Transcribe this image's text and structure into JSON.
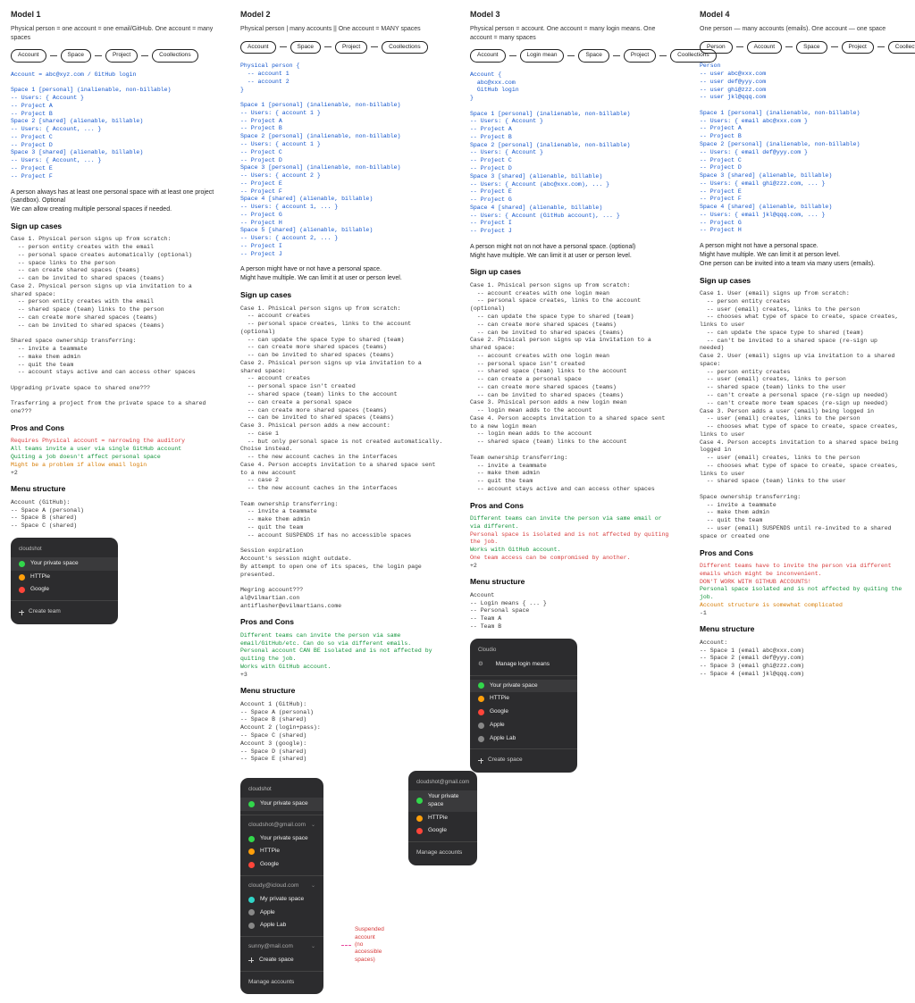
{
  "models": {
    "m1": {
      "title": "Model 1",
      "subtitle": "Physical person = one account = one email/GitHub. One account = many spaces",
      "pills": [
        "Account",
        "Space",
        "Project",
        "Coollections"
      ],
      "hierarchy": "Account = abc@xyz.com / GitHub login\n\nSpace 1 [personal] (inalienable, non-billable)\n-- Users: { Account }\n-- Project A\n-- Project B\nSpace 2 [shared] (alienable, billable)\n-- Users: { Account, ... }\n-- Project C\n-- Project D\nSpace 3 [shared] (alienable, billable)\n-- Users: { Account, ... }\n-- Project E\n-- Project F",
      "note": "A person always has at least one personal space with at least one project (sandbox). Optional\nWe can allow creating multiple personal spaces if needed.",
      "signup_title": "Sign up cases",
      "signup": "Case 1. Physical person signs up from scratch:\n  -- person entity creates with the email\n  -- personal space creates automatically (optional)\n  -- space links to the person\n  -- can create shared spaces (teams)\n  -- can be invited to shared spaces (teams)\nCase 2. Physical person signs up via invitation to a shared space:\n  -- person entity creates with the email\n  -- shared space (team) links to the person\n  -- can create more shared spaces (teams)\n  -- can be invited to shared spaces (teams)\n\nShared space ownership transferring:\n  -- invite a teammate\n  -- make them admin\n  -- quit the team\n  -- account stays active and can access other spaces\n\nUpgrading private space to shared one???\n\nTrasferring a project from the private space to a shared one???",
      "proscons_title": "Pros and Cons",
      "proscons_html": "<span class='r'>Requires Physical account = narrowing the auditory</span>\n<span class='g'>All teams invite a user via single GitHub account</span>\n<span class='g'>Quiting a job doesn't affect personal space</span>\n<span class='o'>Might be a problem if allow email login</span>\n+2",
      "menu_title": "Menu structure",
      "menu": "Account (GitHub):\n-- Space A (personal)\n-- Space B (shared)\n-- Space C (shared)",
      "panel": {
        "header": "cloudshot",
        "items": [
          {
            "dot": "green",
            "label": "Your private space",
            "sel": true
          },
          {
            "dot": "orange",
            "label": "HTTPie"
          },
          {
            "dot": "red",
            "label": "Google"
          }
        ],
        "footer": "Create team"
      }
    },
    "m2": {
      "title": "Model 2",
      "subtitle": "Physical person | many accounts || One account = MANY spaces",
      "pills": [
        "Account",
        "Space",
        "Project",
        "Coollections"
      ],
      "hierarchy": "Physical person {\n  -- account 1\n  -- account 2\n}\n\nSpace 1 [personal] (inalienable, non-billable)\n-- Users: { account 1 }\n-- Project A\n-- Project B\nSpace 2 [personal] (inalienable, non-billable)\n-- Users: { account 1 }\n-- Project C\n-- Project D\nSpace 3 [personal] (inalienable, non-billable)\n-- Users: { account 2 }\n-- Project E\n-- Project F\nSpace 4 [shared] (alienable, billable)\n-- Users: { account 1, ... }\n-- Project G\n-- Project H\nSpace 5 [shared] (alienable, billable)\n-- Users: { account 2, ... }\n-- Project I\n-- Project J",
      "note": "A person might have or not have a personal space.\nMight have multiple. We can limit it at user or person level.",
      "signup_title": "Sign up cases",
      "signup": "Case 1. Phisical person signs up from scratch:\n  -- account creates\n  -- personal space creates, links to the account (optional)\n  -- can update the space type to shared (team)\n  -- can create more shared spaces (teams)\n  -- can be invited to shared spaces (teams)\nCase 2. Phisical person signs up via invitation to a shared space:\n  -- account creates\n  -- personal space isn't created\n  -- shared space (team) links to the account\n  -- can create a personal space\n  -- can create more shared spaces (teams)\n  -- can be invited to shared spaces (teams)\nCase 3. Phisical person adds a new account:\n  -- case 1\n  -- but only personal space is not created automatically.\nChoise instead.\n  -- the new account caches in the interfaces\nCase 4. Person accepts invitation to a shared space sent to a new account\n  -- case 2\n  -- the new account caches in the interfaces\n\nTeam ownership transferring:\n  -- invite a teammate\n  -- make them admin\n  -- quit the team\n  -- account SUSPENDS if has no accessible spaces\n\nSession expiration\nAccount's session might outdate.\nBy attempt to open one of its spaces, the login page presented.\n\nMegring account???\nal@vilmartian.con\nantiflasher@evilmartians.come",
      "proscons_title": "Pros and Cons",
      "proscons_html": "<span class='g'>Different teams can invite the person via same email/GitHub/etc. Can do so via different emails.</span>\n<span class='g'>Personal account CAN BE isolated and is not affected by quiting the job.</span>\n<span class='g'>Works with GitHub account.</span>\n+3",
      "menu_title": "Menu structure",
      "menu": "Account 1 (GitHub):\n-- Space A (personal)\n-- Space B (shared)\nAccount 2 (login+pass):\n-- Space C (shared)\nAccount 3 (google):\n-- Space D (shared)\n-- Space E (shared)",
      "panelA": {
        "header": "cloudshot",
        "blocks": [
          {
            "email": "cloudshot@gmail.com",
            "items": [
              {
                "dot": "green",
                "label": "Your private space",
                "sel": true
              },
              {
                "dot": "orange",
                "label": "HTTPie"
              },
              {
                "dot": "red",
                "label": "Google"
              }
            ]
          },
          {
            "email": "cloudy@icloud.com",
            "items": [
              {
                "dot": "teal",
                "label": "My private space"
              },
              {
                "dot": "gray",
                "label": "Apple"
              },
              {
                "dot": "gray",
                "label": "Apple Lab"
              }
            ]
          },
          {
            "email": "sunny@mail.com",
            "items": [],
            "suspended": true
          }
        ],
        "create": "Create space",
        "footer": "Manage accounts"
      },
      "panelB": {
        "header": "cloudshot@gmail.com",
        "items": [
          {
            "dot": "green",
            "label": "Your private space",
            "sel": true
          },
          {
            "dot": "orange",
            "label": "HTTPie"
          },
          {
            "dot": "red",
            "label": "Google"
          }
        ],
        "footer": "Manage accounts"
      },
      "suspended_label": "Suspended account",
      "suspended_sub": "(no accessible spaces)"
    },
    "m3": {
      "title": "Model 3",
      "subtitle": "Physical person = account. One account = many login means. One account = many spaces",
      "pills": [
        "Account",
        "Login mean",
        "Space",
        "Project",
        "Coollections"
      ],
      "hierarchy": "Account {\n  abc@xxx.com\n  GitHub login\n}\n\nSpace 1 [personal] (inalienable, non-billable)\n-- Users: { Account }\n-- Project A\n-- Project B\nSpace 2 [personal] (inalienable, non-billable)\n-- Users: { Account }\n-- Project C\n-- Project D\nSpace 3 [shared] (alienable, billable)\n-- Users: { Account (abc@xxx.com), ... }\n-- Project E\n-- Project G\nSpace 4 [shared] (alienable, billable)\n-- Users: { Account (GitHub account), ... }\n-- Project I\n-- Project J",
      "note": "A person might not on not have a personal space. (optional)\nMight have multiple. We can limit it at user or person level.",
      "signup_title": "Sign up cases",
      "signup": "Case 1. Phisical person signs up from scratch:\n  -- account creates with one login mean\n  -- personal space creates, links to the account (optional)\n  -- can update the space type to shared (team)\n  -- can create more shared spaces (teams)\n  -- can be invited to shared spaces (teams)\nCase 2. Phisical person signs up via invitation to a shared space:\n  -- account creates with one login mean\n  -- personal space isn't created\n  -- shared space (team) links to the account\n  -- can create a personal space\n  -- can create more shared spaces (teams)\n  -- can be invited to shared spaces (teams)\nCase 3. Phisical person adds a new login mean\n  -- login mean adds to the account\nCase 4. Person accepts invitation to a shared space sent to a new login mean\n  -- login mean adds to the account\n  -- shared space (team) links to the account\n\nTeam ownership transferring:\n  -- invite a teammate\n  -- make them admin\n  -- quit the team\n  -- account stays active and can access other spaces",
      "proscons_title": "Pros and Cons",
      "proscons_html": "<span class='g'>Different teams can invite the person via same email or via different.</span>\n<span class='r'>Personal space is isolated and is not affected by quiting the job.</span>\n<span class='g'>Works with GitHub account.</span>\n<span class='r'>One team access can be compromised by another.</span>\n+2",
      "menu_title": "Menu structure",
      "menu": "Account\n-- Login means { ... }\n-- Personal space\n-- Team A\n-- Team B",
      "panel": {
        "header": "Cloudio",
        "manage": "Manage login means",
        "items": [
          {
            "dot": "green",
            "label": "Your private space",
            "sel": true
          },
          {
            "dot": "orange",
            "label": "HTTPie"
          },
          {
            "dot": "red",
            "label": "Google"
          },
          {
            "dot": "gray",
            "label": "Apple"
          },
          {
            "dot": "gray",
            "label": "Apple Lab"
          }
        ],
        "footer": "Create space"
      }
    },
    "m4": {
      "title": "Model 4",
      "subtitle": "One person — many accounts (emails). One account — one space",
      "pills": [
        "Person",
        "Account",
        "Space",
        "Project",
        "Coollections"
      ],
      "hierarchy": "Person\n-- user abc@xxx.com\n-- user def@yyy.com\n-- user ghi@zzz.com\n-- user jkl@qqq.com\n\nSpace 1 [personal] (inalienable, non-billable)\n-- Users: { email abc@xxx.com }\n-- Project A\n-- Project B\nSpace 2 [personal] (inalienable, non-billable)\n-- Users: { email def@yyy.com }\n-- Project C\n-- Project D\nSpace 3 [shared] (alienable, billable)\n-- Users: { email ghi@zzz.com, ... }\n-- Project E\n-- Project F\nSpace 4 [shared] (alienable, billable)\n-- Users: { email jkl@qqq.com, ... }\n-- Project G\n-- Project H",
      "note": "A person might not have a personal space.\nMight have multiple. We can limit it at person level.\nOne person can be invited into a team via many users (emails).",
      "signup_title": "Sign up cases",
      "signup": "Case 1. User (email) signs up from scratch:\n  -- person entity creates\n  -- user (email) creates, links to the person\n  -- chooses what type of space to create, space creates, links to user\n  -- can update the space type to shared (team)\n  -- can't be invited to a shared space (re-sign up needed)\nCase 2. User (email) signs up via invitation to a shared space:\n  -- person entity creates\n  -- user (email) creates, links to person\n  -- shared space (team) links to the user\n  -- can't create a personal space (re-sign up needed)\n  -- can't create more team spaces (re-sign up needed)\nCase 3. Person adds a user (email) being logged in\n  -- user (email) creates, links to the person\n  -- chooses what type of space to create, space creates, links to user\nCase 4. Person accepts invitation to a shared space being logged in\n  -- user (email) creates, links to the person\n  -- chooses what type of space to create, space creates, links to user\n  -- shared space (team) links to the user\n\nSpace ownership transferring:\n  -- invite a teammate\n  -- make them admin\n  -- quit the team\n  -- user (email) SUSPENDS until re-invited to a shared space or created one",
      "proscons_title": "Pros and Cons",
      "proscons_html": "<span class='r'>Different teams have to invite the person via different emails which might be inconvenient.</span>\n<span class='r'>DON'T WORK WITH GITHUB ACCOUNTS!</span>\n<span class='g'>Personal space isolated and is not affected by quiting the job.</span>\n<span class='o'>Account structure is somewhat complicated</span>\n-1",
      "menu_title": "Menu structure",
      "menu": "Account:\n-- Space 1 (email abc@xxx.com)\n-- Space 2 (email def@yyy.com)\n-- Space 3 (email ghi@zzz.com)\n-- Space 4 (email jkl@qqq.com)"
    }
  }
}
